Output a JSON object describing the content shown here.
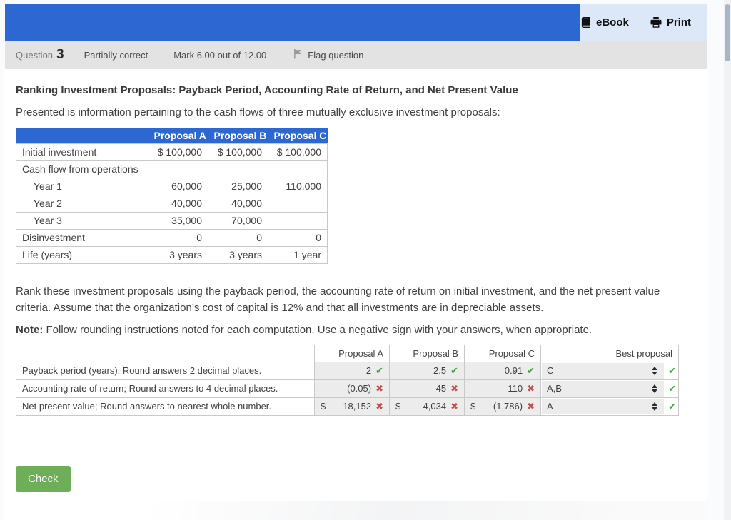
{
  "header": {
    "ebook_label": "eBook",
    "print_label": "Print"
  },
  "question_bar": {
    "question_label": "Question",
    "question_number": "3",
    "status": "Partially correct",
    "mark": "Mark 6.00 out of 12.00",
    "flag_label": "Flag question"
  },
  "content": {
    "title": "Ranking Investment Proposals: Payback Period, Accounting Rate of Return, and Net Present Value",
    "intro": "Presented is information pertaining to the cash flows of three mutually exclusive investment proposals:",
    "cashflow_table": {
      "headers": [
        "",
        "Proposal A",
        "Proposal B",
        "Proposal C"
      ],
      "rows": [
        {
          "label": "Initial investment",
          "indent": false,
          "values": [
            "$ 100,000",
            "$ 100,000",
            "$ 100,000"
          ]
        },
        {
          "label": "Cash flow from operations",
          "indent": false,
          "values": [
            "",
            "",
            ""
          ]
        },
        {
          "label": "Year 1",
          "indent": true,
          "values": [
            "60,000",
            "25,000",
            "110,000"
          ]
        },
        {
          "label": "Year 2",
          "indent": true,
          "values": [
            "40,000",
            "40,000",
            ""
          ]
        },
        {
          "label": "Year 3",
          "indent": true,
          "values": [
            "35,000",
            "70,000",
            ""
          ]
        },
        {
          "label": "Disinvestment",
          "indent": false,
          "values": [
            "0",
            "0",
            "0"
          ]
        },
        {
          "label": "Life (years)",
          "indent": false,
          "values": [
            "3 years",
            "3 years",
            "1 year"
          ]
        }
      ]
    },
    "instructions": "Rank these investment proposals using the payback period, the accounting rate of return on initial investment, and the net present value criteria. Assume that the organization’s cost of capital is 12% and that all investments are in depreciable assets.",
    "note_label": "Note:",
    "note_text": " Follow rounding instructions noted for each computation.  Use a negative sign with your answers, when appropriate.",
    "answer_table": {
      "headers": [
        "",
        "Proposal A",
        "Proposal B",
        "Proposal C",
        "Best proposal"
      ],
      "rows": [
        {
          "label": "Payback period (years); Round answers 2 decimal places.",
          "answers": [
            {
              "prefix": "",
              "value": "2",
              "correct": true
            },
            {
              "prefix": "",
              "value": "2.5",
              "correct": true
            },
            {
              "prefix": "",
              "value": "0.91",
              "correct": true
            }
          ],
          "best": {
            "value": "C",
            "correct": true
          }
        },
        {
          "label": "Accounting rate of return; Round answers to 4 decimal places.",
          "answers": [
            {
              "prefix": "",
              "value": "(0.05)",
              "correct": false
            },
            {
              "prefix": "",
              "value": "45",
              "correct": false
            },
            {
              "prefix": "",
              "value": "110",
              "correct": false
            }
          ],
          "best": {
            "value": "A,B",
            "correct": true
          }
        },
        {
          "label": "Net present value; Round answers to nearest whole number.",
          "answers": [
            {
              "prefix": "$",
              "value": "18,152",
              "correct": false
            },
            {
              "prefix": "$",
              "value": "4,034",
              "correct": false
            },
            {
              "prefix": "$",
              "value": "(1,786)",
              "correct": false
            }
          ],
          "best": {
            "value": "A",
            "correct": true
          }
        }
      ]
    },
    "check_button": "Check"
  },
  "marks": {
    "correct_glyph": "✔",
    "incorrect_glyph": "✖"
  },
  "colors": {
    "brand_blue": "#2d68d2",
    "actions_panel_blue": "#dce8f8",
    "question_bar_gray": "#e3e3e3",
    "input_gray": "#ececec",
    "correct_green": "#43a047",
    "incorrect_red": "#c0504d",
    "button_green": "#6fae58"
  }
}
